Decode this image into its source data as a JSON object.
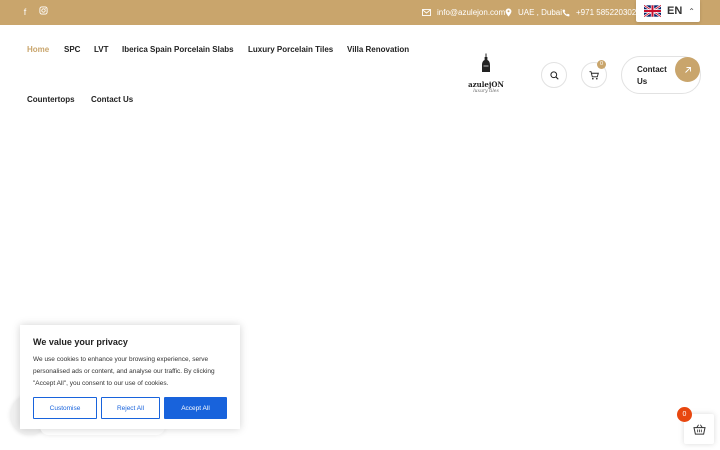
{
  "topbar": {
    "social": [
      "facebook-icon",
      "instagram-icon"
    ],
    "email": "info@azulejon.com",
    "location": "UAE , Dubai",
    "phone": "+971 585220302",
    "accent": "#c9a56c"
  },
  "language": {
    "code": "EN"
  },
  "nav": {
    "items": [
      {
        "label": "Home",
        "active": true
      },
      {
        "label": "SPC"
      },
      {
        "label": "LVT"
      },
      {
        "label": "Iberica Spain Porcelain Slabs"
      },
      {
        "label": "Luxury Porcelain Tiles"
      },
      {
        "label": "Villa Renovation"
      },
      {
        "label": "Countertops"
      },
      {
        "label": "Contact Us"
      }
    ]
  },
  "logo": {
    "wordmark": "azulejON",
    "tagline": "luxury tiles"
  },
  "header": {
    "cart_count": "0",
    "contact_label": "Contact Us"
  },
  "cookie": {
    "title": "We value your privacy",
    "body": "We use cookies to enhance your browsing experience, serve personalised ads or content, and analyse our traffic. By clicking \"Accept All\", you consent to our use of cookies.",
    "customise": "Customise",
    "reject": "Reject All",
    "accept": "Accept All",
    "button_color": "#1863dc"
  },
  "floating_cart": {
    "count": "0",
    "badge_color": "#e8470f"
  }
}
